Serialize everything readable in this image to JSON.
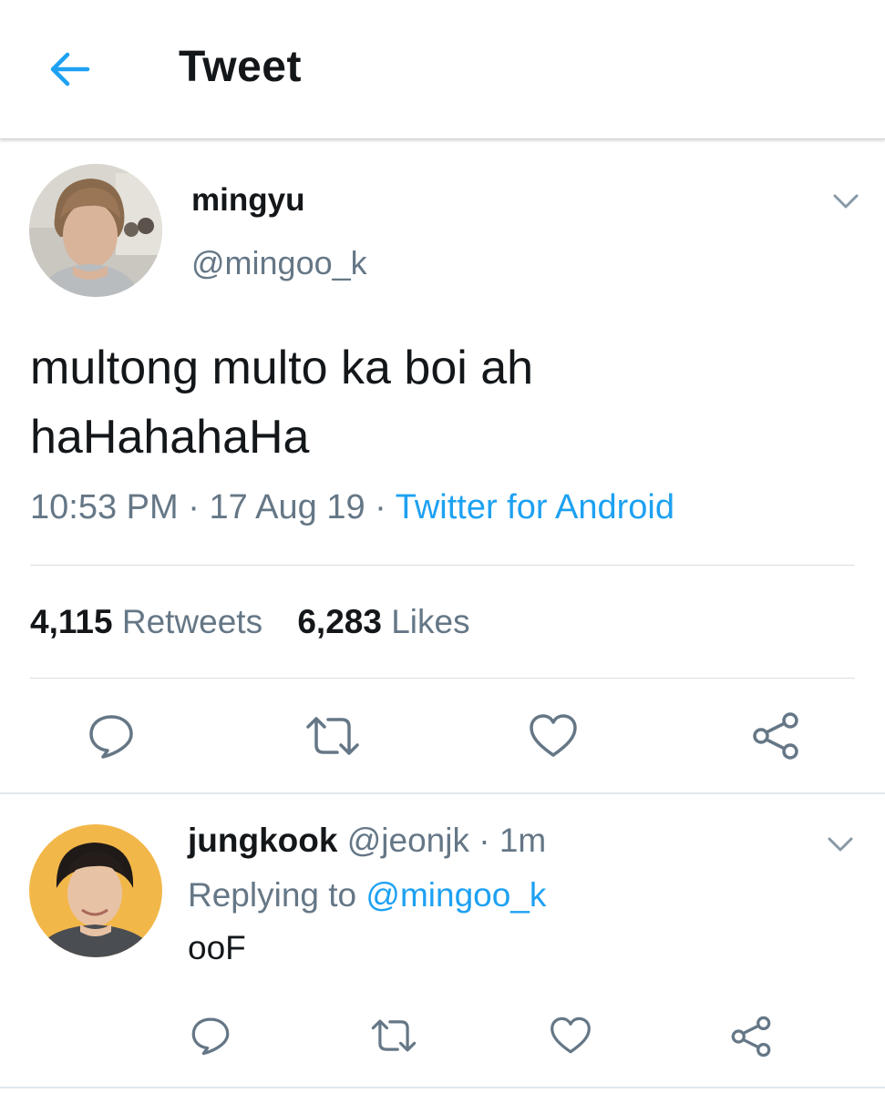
{
  "header": {
    "title": "Tweet",
    "back_icon": "arrow-left-icon",
    "accent_color": "#1da1f2"
  },
  "tweet": {
    "author": {
      "name": "mingyu",
      "handle": "@mingoo_k",
      "avatar": "profile-photo"
    },
    "text_lines": [
      "multong multo ka boi ah",
      "haHahahaHa"
    ],
    "time": "10:53 PM",
    "date": "17 Aug 19",
    "separator": " · ",
    "source": "Twitter for Android",
    "stats": {
      "retweets_count": "4,115",
      "retweets_label": "Retweets",
      "likes_count": "6,283",
      "likes_label": "Likes"
    },
    "actions": [
      "reply-icon",
      "retweet-icon",
      "like-icon",
      "share-icon"
    ]
  },
  "reply": {
    "author": {
      "name": "jungkook",
      "handle": "@jeonjk",
      "avatar": "profile-photo"
    },
    "dot": "·",
    "time": "1m",
    "replying_to_label": "Replying to",
    "replying_to_handle": "@mingoo_k",
    "text": "ooF",
    "actions": [
      "reply-icon",
      "retweet-icon",
      "like-icon",
      "share-icon"
    ]
  },
  "colors": {
    "text_primary": "#14171a",
    "text_secondary": "#657786",
    "link": "#1da1f2",
    "divider": "#d7dde1"
  }
}
